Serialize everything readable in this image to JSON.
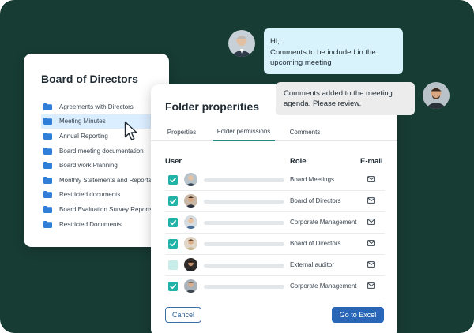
{
  "board": {
    "title": "Board of Directors",
    "folders": [
      {
        "label": "Agreements with Directors",
        "selected": false
      },
      {
        "label": "Meeting Minutes",
        "selected": true
      },
      {
        "label": "Annual Reporting",
        "selected": false
      },
      {
        "label": "Board meeting documentation",
        "selected": false
      },
      {
        "label": "Board work Planning",
        "selected": false
      },
      {
        "label": "Monthly Statements and Reports",
        "selected": false
      },
      {
        "label": "Restricted documents",
        "selected": false
      },
      {
        "label": "Board Evaluation Survey Reports",
        "selected": false
      },
      {
        "label": "Restricted Documents",
        "selected": false
      }
    ]
  },
  "properties": {
    "title": "Folder properities",
    "tabs": [
      {
        "label": "Properties",
        "active": false
      },
      {
        "label": "Folder permissions",
        "active": true
      },
      {
        "label": "Comments",
        "active": false
      }
    ],
    "columns": {
      "user": "User",
      "role": "Role",
      "email": "E-mail"
    },
    "rows": [
      {
        "role": "Board Meetings",
        "checked": true
      },
      {
        "role": "Board of Directors",
        "checked": true
      },
      {
        "role": "Corporate Management",
        "checked": true
      },
      {
        "role": "Board of Directors",
        "checked": true
      },
      {
        "role": "External auditor",
        "checked": false
      },
      {
        "role": "Corporate Management",
        "checked": true
      }
    ],
    "cancel_label": "Cancel",
    "excel_label": "Go to Excel"
  },
  "chat": {
    "message1": [
      "Hi,",
      "Comments to be included in the",
      "upcoming meeting"
    ],
    "message2": [
      "Comments added to the meeting",
      "agenda. Please review."
    ]
  },
  "colors": {
    "background": "#173c33",
    "accent": "#22b3a8",
    "primary_button": "#2a66b8",
    "folder": "#2f7fd9"
  },
  "icons": {
    "folder": "folder-icon",
    "cursor": "cursor-arrow-icon",
    "mail": "mail-icon",
    "checkbox": "checkbox-icon"
  }
}
